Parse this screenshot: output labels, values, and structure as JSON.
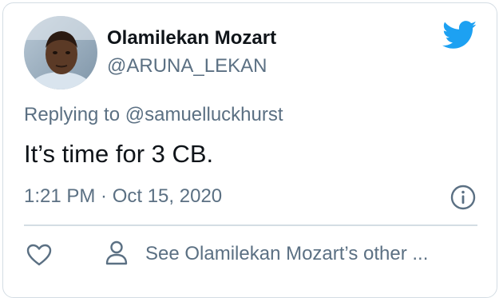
{
  "tweet": {
    "author_name": "Olamilekan Mozart",
    "author_handle": "@ARUNA_LEKAN",
    "replying_prefix": "Replying to",
    "replying_to": "@samuelluckhurst",
    "text": "It’s time for 3 CB.",
    "timestamp": "1:21 PM · Oct 15, 2020",
    "see_other_label": "See Olamilekan Mozart’s other ..."
  },
  "icons": {
    "brand": "twitter-bird-icon",
    "info": "info-icon",
    "like": "heart-icon",
    "profile": "person-icon"
  },
  "colors": {
    "brand_blue": "#1da1f2",
    "text_primary": "#0f1419",
    "text_secondary": "#5b7083",
    "border": "#d4dde4"
  }
}
